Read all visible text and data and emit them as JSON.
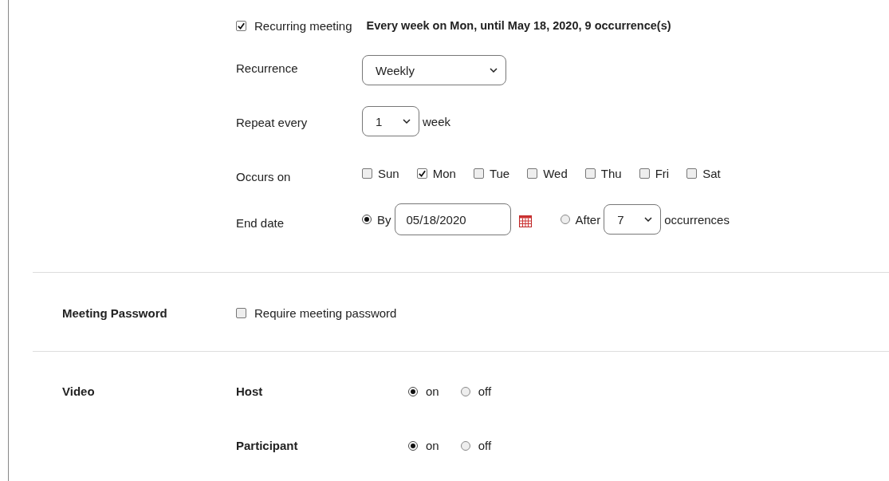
{
  "recurring": {
    "label": "Recurring meeting",
    "checked": true,
    "summary": "Every week on Mon, until May 18, 2020, 9 occurrence(s)"
  },
  "recurrence": {
    "label": "Recurrence",
    "value": "Weekly"
  },
  "repeat": {
    "label": "Repeat every",
    "value": "1",
    "unit": "week"
  },
  "occurs": {
    "label": "Occurs on",
    "days": [
      {
        "label": "Sun",
        "checked": false
      },
      {
        "label": "Mon",
        "checked": true
      },
      {
        "label": "Tue",
        "checked": false
      },
      {
        "label": "Wed",
        "checked": false
      },
      {
        "label": "Thu",
        "checked": false
      },
      {
        "label": "Fri",
        "checked": false
      },
      {
        "label": "Sat",
        "checked": false
      }
    ]
  },
  "end_date": {
    "label": "End date",
    "options": [
      {
        "kind": "date",
        "label": "By",
        "selected": true,
        "value": "05/18/2020"
      },
      {
        "kind": "count",
        "label": "After",
        "selected": false,
        "value": "7",
        "unit": "occurrences"
      }
    ]
  },
  "password": {
    "label": "Meeting Password",
    "option": "Require meeting password",
    "checked": false
  },
  "video": {
    "label": "Video",
    "rows": [
      {
        "label": "Host",
        "options": [
          {
            "label": "on",
            "selected": true
          },
          {
            "label": "off",
            "selected": false
          }
        ]
      },
      {
        "label": "Participant",
        "options": [
          {
            "label": "on",
            "selected": true
          },
          {
            "label": "off",
            "selected": false
          }
        ]
      }
    ]
  }
}
